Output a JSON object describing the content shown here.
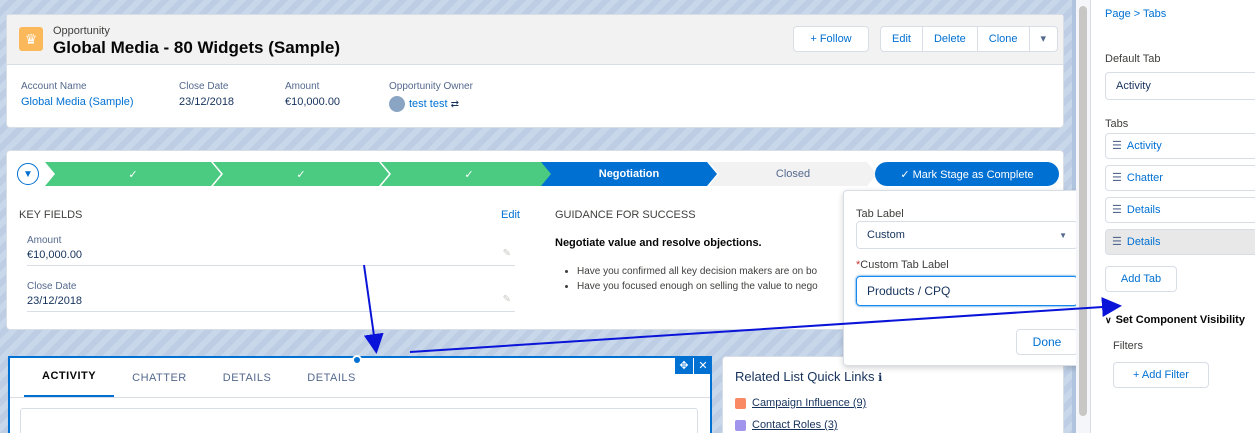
{
  "record": {
    "object_type": "Opportunity",
    "name": "Global Media - 80 Widgets (Sample)",
    "follow_label": "+ Follow",
    "actions": [
      "Edit",
      "Delete",
      "Clone",
      "▾"
    ],
    "fields": [
      {
        "label": "Account Name",
        "value": "Global Media (Sample)"
      },
      {
        "label": "Close Date",
        "value": "23/12/2018"
      },
      {
        "label": "Amount",
        "value": "€10,000.00"
      },
      {
        "label": "Opportunity Owner",
        "value": "test test"
      }
    ]
  },
  "path": {
    "stages": [
      "✓",
      "✓",
      "✓",
      "Negotiation",
      "Closed"
    ],
    "mark_complete_label": "✓  Mark Stage as Complete",
    "toggle_icon": "chevron-down-icon"
  },
  "key_fields": {
    "title": "KEY FIELDS",
    "edit_label": "Edit",
    "items": [
      {
        "label": "Amount",
        "value": "€10,000.00"
      },
      {
        "label": "Close Date",
        "value": "23/12/2018"
      }
    ]
  },
  "guidance": {
    "title": "GUIDANCE FOR SUCCESS",
    "headline": "Negotiate value and resolve objections.",
    "bullets": [
      "Have you confirmed all key decision makers are on bo",
      "Have you focused enough on selling the value to nego"
    ]
  },
  "tabs": {
    "items": [
      "ACTIVITY",
      "CHATTER",
      "DETAILS",
      "DETAILS"
    ]
  },
  "related": {
    "title": "Related List Quick Links",
    "items": [
      "Campaign Influence (9)",
      "Contact Roles (3)"
    ]
  },
  "popover": {
    "tab_label_caption": "Tab Label",
    "tab_label_value": "Custom",
    "custom_caption": "Custom Tab Label",
    "custom_value": "Products / CPQ",
    "done_label": "Done"
  },
  "panel": {
    "breadcrumb": "Page  >  Tabs",
    "default_tab_caption": "Default Tab",
    "default_tab_value": "Activity",
    "tabs_caption": "Tabs",
    "tabs": [
      "Activity",
      "Chatter",
      "Details",
      "Details"
    ],
    "add_tab_label": "Add Tab",
    "visibility_label": "Set Component Visibility",
    "filters_caption": "Filters",
    "add_filter_label": "+ Add Filter"
  },
  "colors": {
    "brand": "#0070d2",
    "path_done": "#4bca81",
    "annotation_arrow": "#0a14d8"
  }
}
